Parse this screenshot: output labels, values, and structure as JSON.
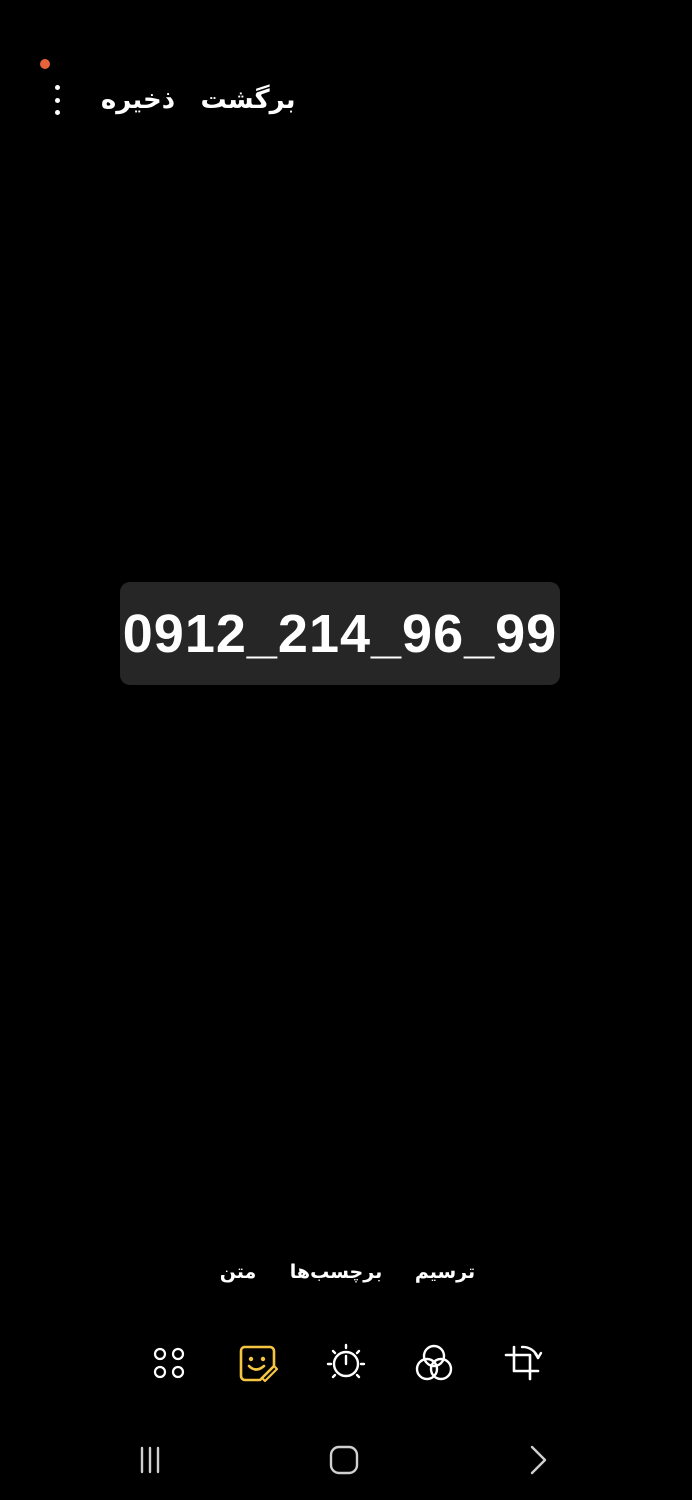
{
  "header": {
    "back_label": "برگشت",
    "save_label": "ذخیره",
    "more_icon": "more-vertical-icon",
    "notification_dot_color": "#e8633a"
  },
  "canvas": {
    "sticker_text": "0912_214_96_99",
    "sticker_background": "#262626"
  },
  "tools": {
    "tabs": [
      {
        "label": "ترسیم"
      },
      {
        "label": "برچسب‌ها"
      },
      {
        "label": "متن"
      }
    ],
    "icons": [
      {
        "name": "crop-rotate-icon"
      },
      {
        "name": "filter-icon"
      },
      {
        "name": "adjust-brightness-icon"
      },
      {
        "name": "sticker-icon",
        "active": true,
        "color": "#f5c542"
      },
      {
        "name": "more-tools-icon"
      }
    ]
  },
  "navigation": {
    "items": [
      "recents-icon",
      "home-icon",
      "back-icon"
    ]
  }
}
